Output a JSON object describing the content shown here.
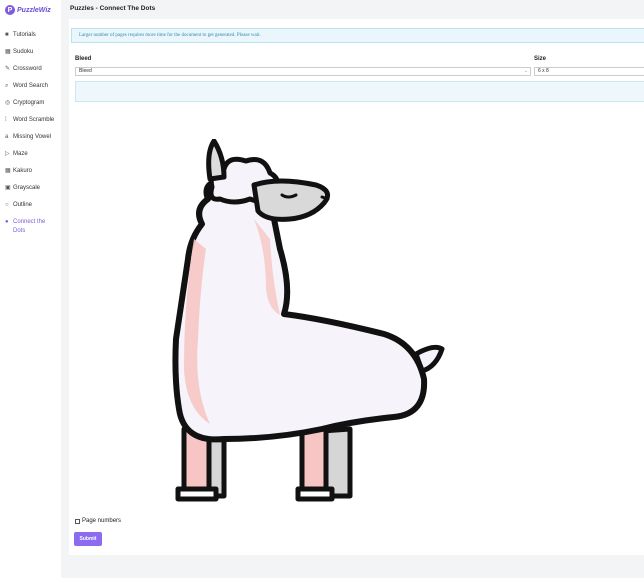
{
  "brand": {
    "mark": "P",
    "name": "PuzzleWiz"
  },
  "sidebar": {
    "items": [
      {
        "icon": "■",
        "label": "Tutorials",
        "active": false
      },
      {
        "icon": "▦",
        "label": "Sudoku",
        "active": false
      },
      {
        "icon": "✎",
        "label": "Crossword",
        "active": false
      },
      {
        "icon": "⌕",
        "label": "Word Search",
        "active": false
      },
      {
        "icon": "◎",
        "label": "Cryptogram",
        "active": false
      },
      {
        "icon": "⁞",
        "label": "Word Scramble",
        "active": false
      },
      {
        "icon": "a",
        "label": "Missing Vowel",
        "active": false
      },
      {
        "icon": "▷",
        "label": "Maze",
        "active": false
      },
      {
        "icon": "▦",
        "label": "Kakuro",
        "active": false
      },
      {
        "icon": "▣",
        "label": "Grayscale",
        "active": false
      },
      {
        "icon": "○",
        "label": "Outline",
        "active": false
      },
      {
        "icon": "●",
        "label": "Connect the Dots",
        "active": true
      }
    ]
  },
  "page": {
    "title": "Puzzles - Connect The Dots"
  },
  "alert": {
    "text": "Larger number of pages requires more time for the document to get generated. Please wait."
  },
  "form": {
    "bleed_label": "Bleed",
    "bleed_value": "Bleed",
    "size_label": "Size",
    "size_value": "6 x 8",
    "page_numbers_label": "Page numbers",
    "submit_label": "Submit"
  },
  "colors": {
    "accent": "#8b6cf0",
    "alert_bg": "#eaf6fb",
    "alert_text": "#2d8cb0"
  }
}
